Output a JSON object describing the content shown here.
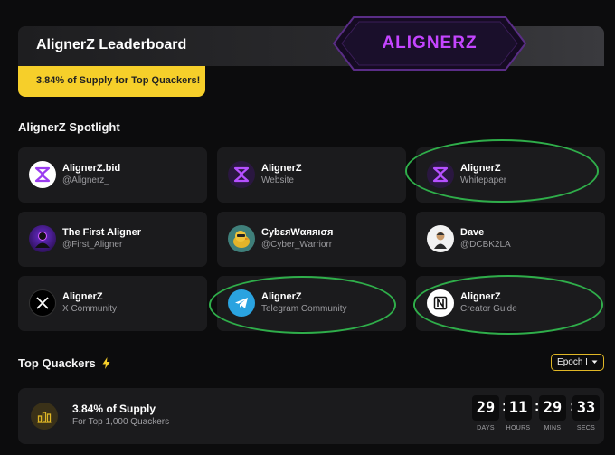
{
  "header": {
    "title": "AlignerZ Leaderboard",
    "brand_logo_text": "ALIGNERZ",
    "promo": "3.84% of Supply for Top Quackers!"
  },
  "spotlight": {
    "title": "AlignerZ Spotlight",
    "cards": [
      {
        "name": "AlignerZ.bid",
        "sub": "@Alignerz_",
        "icon": "alignerz-logo-icon",
        "highlighted": false
      },
      {
        "name": "AlignerZ",
        "sub": "Website",
        "icon": "alignerz-logo-icon",
        "highlighted": false
      },
      {
        "name": "AlignerZ",
        "sub": "Whitepaper",
        "icon": "alignerz-logo-icon",
        "highlighted": true
      },
      {
        "name": "The First Aligner",
        "sub": "@First_Aligner",
        "icon": "profile-avatar-icon",
        "highlighted": false
      },
      {
        "name": "CybεяWαяяıσя",
        "sub": "@Cyber_Warriorr",
        "icon": "duck-avatar-icon",
        "highlighted": false
      },
      {
        "name": "Dave",
        "sub": "@DCBK2LA",
        "icon": "person-avatar-icon",
        "highlighted": false
      },
      {
        "name": "AlignerZ",
        "sub": "X Community",
        "icon": "x-logo-icon",
        "highlighted": false
      },
      {
        "name": "AlignerZ",
        "sub": "Telegram Community",
        "icon": "telegram-icon",
        "highlighted": true
      },
      {
        "name": "AlignerZ",
        "sub": "Creator Guide",
        "icon": "notion-icon",
        "highlighted": true
      }
    ]
  },
  "quackers": {
    "title": "Top Quackers",
    "bolt_icon": "lightning-icon",
    "epoch_label": "Epoch I",
    "supply_title": "3.84% of Supply",
    "supply_sub": "For Top 1,000 Quackers",
    "countdown": [
      {
        "value": "29",
        "label": "DAYS"
      },
      {
        "value": "11",
        "label": "HOURS"
      },
      {
        "value": "29",
        "label": "MINS"
      },
      {
        "value": "33",
        "label": "SECS"
      }
    ]
  },
  "colors": {
    "accent_yellow": "#f6cf2a",
    "brand_purple": "#c445ff",
    "highlight_green": "#2fae4a",
    "card_bg": "#1b1b1d",
    "page_bg": "#0c0c0d"
  }
}
